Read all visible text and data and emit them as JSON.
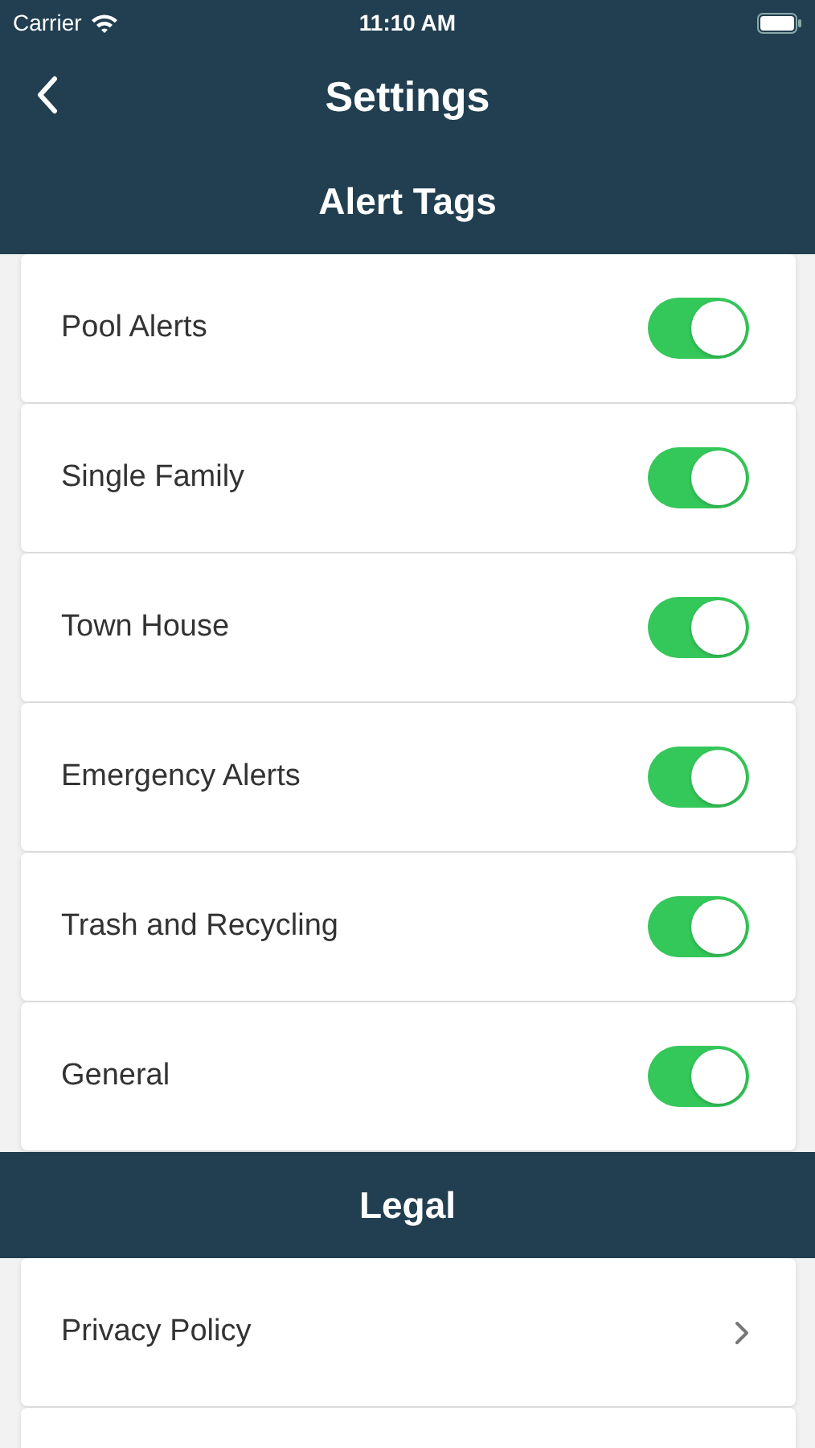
{
  "status_bar": {
    "carrier": "Carrier",
    "time": "11:10 AM"
  },
  "nav": {
    "title": "Settings"
  },
  "sections": [
    {
      "title": "Alert Tags",
      "rows": [
        {
          "kind": "toggle",
          "label": "Pool Alerts",
          "on": true
        },
        {
          "kind": "toggle",
          "label": "Single Family",
          "on": true
        },
        {
          "kind": "toggle",
          "label": "Town House",
          "on": true
        },
        {
          "kind": "toggle",
          "label": "Emergency Alerts",
          "on": true
        },
        {
          "kind": "toggle",
          "label": "Trash and Recycling",
          "on": true
        },
        {
          "kind": "toggle",
          "label": "General",
          "on": true
        }
      ]
    },
    {
      "title": "Legal",
      "rows": [
        {
          "kind": "link",
          "label": "Privacy Policy"
        },
        {
          "kind": "blank"
        }
      ]
    }
  ]
}
